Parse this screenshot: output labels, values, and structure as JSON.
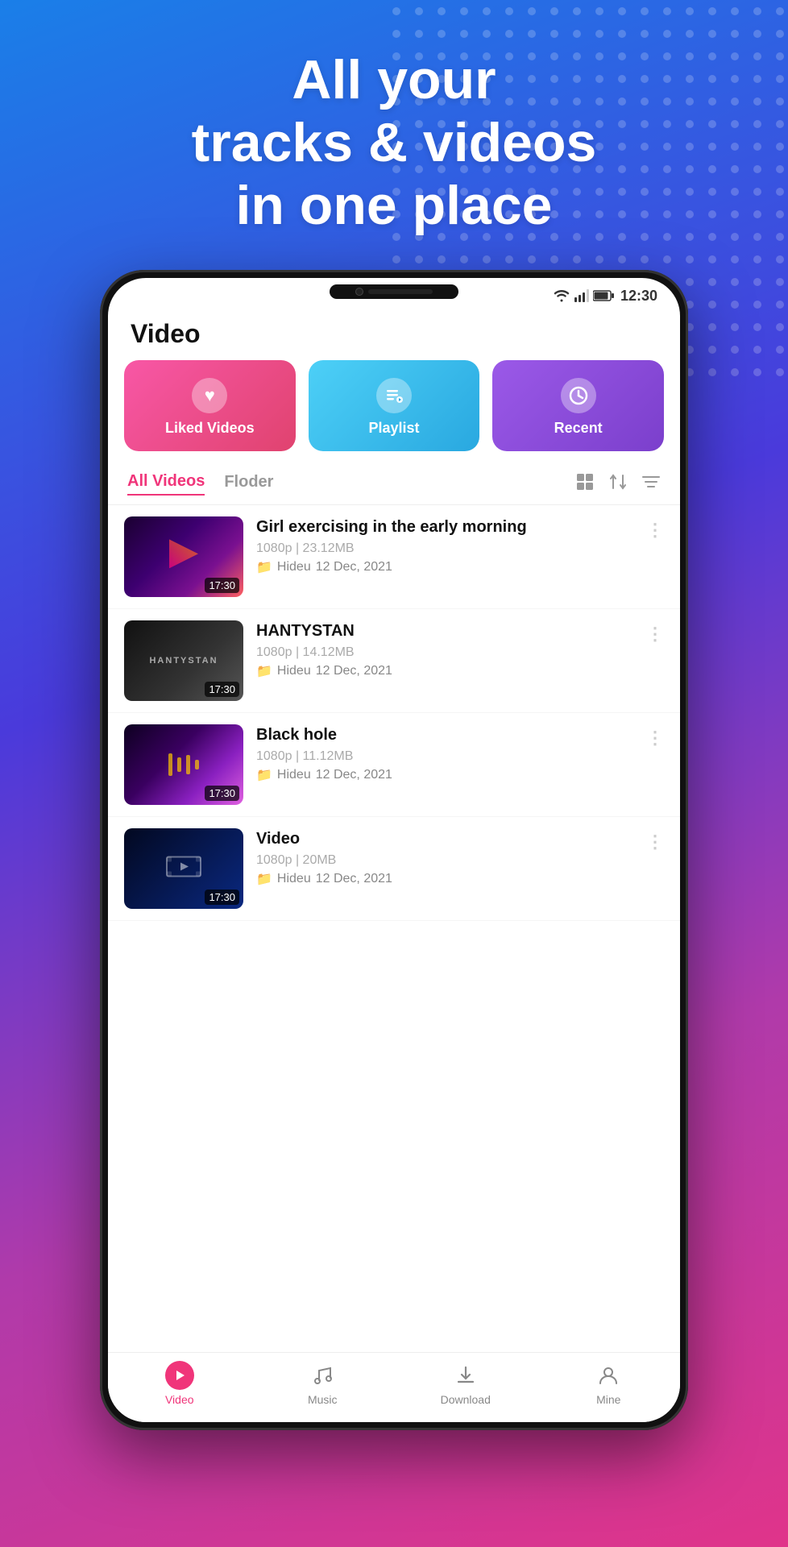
{
  "hero": {
    "line1": "All your",
    "line2": "tracks & videos",
    "line3": "in one place"
  },
  "status_bar": {
    "time": "12:30"
  },
  "page": {
    "title": "Video"
  },
  "categories": [
    {
      "id": "liked",
      "label": "Liked Videos",
      "icon": "♥"
    },
    {
      "id": "playlist",
      "label": "Playlist",
      "icon": "🎵"
    },
    {
      "id": "recent",
      "label": "Recent",
      "icon": "🕐"
    }
  ],
  "tabs": [
    {
      "id": "all-videos",
      "label": "All Videos",
      "active": true
    },
    {
      "id": "folder",
      "label": "Floder",
      "active": false
    }
  ],
  "videos": [
    {
      "id": 1,
      "title": "Girl exercising in the early morning",
      "resolution": "1080p",
      "size": "23.12MB",
      "folder": "Hideu",
      "date": "12 Dec, 2021",
      "duration": "17:30",
      "thumb_class": "thumb-v1"
    },
    {
      "id": 2,
      "title": "HANTYSTAN",
      "resolution": "1080p",
      "size": "14.12MB",
      "folder": "Hideu",
      "date": "12 Dec, 2021",
      "duration": "17:30",
      "thumb_class": "thumb-v2"
    },
    {
      "id": 3,
      "title": "Black hole",
      "resolution": "1080p",
      "size": "11.12MB",
      "folder": "Hideu",
      "date": "12 Dec, 2021",
      "duration": "17:30",
      "thumb_class": "thumb-v3"
    },
    {
      "id": 4,
      "title": "Video",
      "resolution": "1080p",
      "size": "20MB",
      "folder": "Hideu",
      "date": "12 Dec, 2021",
      "duration": "17:30",
      "thumb_class": "thumb-v4"
    }
  ],
  "bottom_nav": [
    {
      "id": "video",
      "label": "Video",
      "active": true
    },
    {
      "id": "music",
      "label": "Music",
      "active": false
    },
    {
      "id": "download",
      "label": "Download",
      "active": false
    },
    {
      "id": "mine",
      "label": "Mine",
      "active": false
    }
  ],
  "colors": {
    "accent_pink": "#f0357a",
    "cat_liked": "#f857a6",
    "cat_playlist": "#4dd0f7",
    "cat_recent": "#9b59e8",
    "folder_yellow": "#f5b731"
  }
}
